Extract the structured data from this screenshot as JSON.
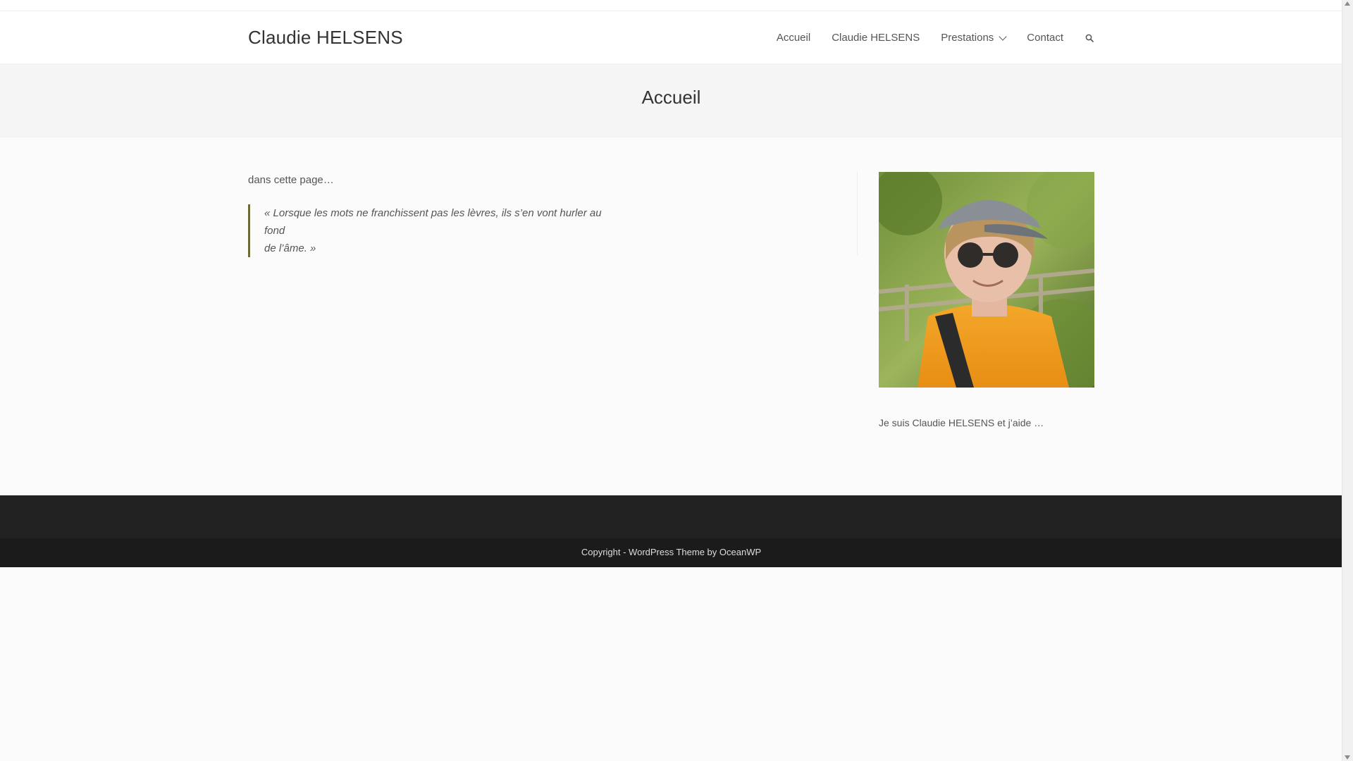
{
  "site": {
    "title": "Claudie HELSENS"
  },
  "nav": {
    "items": [
      {
        "label": "Accueil"
      },
      {
        "label": "Claudie HELSENS"
      },
      {
        "label": "Prestations"
      },
      {
        "label": "Contact"
      }
    ]
  },
  "page": {
    "title": "Accueil"
  },
  "content": {
    "intro": "dans cette page…",
    "quote_line1": "« Lorsque les mots ne franchissent pas les lèvres, ils s’en vont hurler au fond",
    "quote_line2": "de l’âme. »"
  },
  "sidebar": {
    "text": "Je suis Claudie HELSENS et j’aide …"
  },
  "footer": {
    "copyright": "Copyright - WordPress Theme by OceanWP"
  },
  "colors": {
    "accent_quote_border": "#6b6b3a",
    "footer_dark": "#222222"
  },
  "icons": {
    "search": "search-icon"
  }
}
